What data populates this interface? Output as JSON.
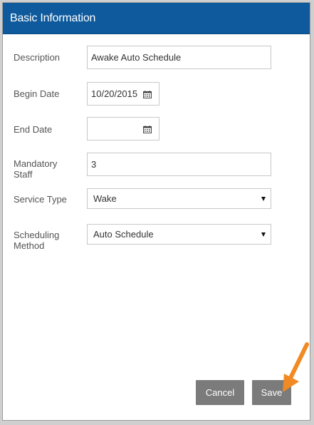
{
  "header": {
    "title": "Basic Information"
  },
  "form": {
    "description": {
      "label": "Description",
      "value": "Awake Auto Schedule"
    },
    "begin_date": {
      "label": "Begin Date",
      "value": "10/20/2015",
      "icon": "calendar-icon"
    },
    "end_date": {
      "label": "End Date",
      "value": "",
      "icon": "calendar-icon"
    },
    "mandatory_staff": {
      "label_line1": "Mandatory",
      "label_line2": "Staff",
      "value": "3"
    },
    "service_type": {
      "label": "Service Type",
      "value": "Wake"
    },
    "scheduling_method": {
      "label_line1": "Scheduling",
      "label_line2": "Method",
      "value": "Auto Schedule"
    }
  },
  "actions": {
    "cancel_label": "Cancel",
    "save_label": "Save"
  },
  "colors": {
    "header_bg": "#0e5a9c",
    "button_bg": "#7b7b7b",
    "arrow": "#f08a24"
  }
}
